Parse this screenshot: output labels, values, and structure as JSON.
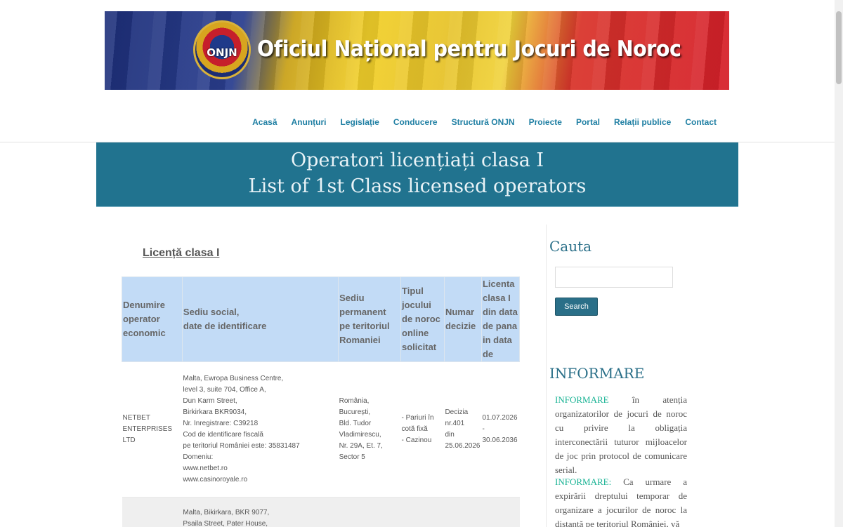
{
  "banner": {
    "seal_label": "ONJN",
    "title": "Oficiul Național pentru Jocuri de Noroc"
  },
  "nav": {
    "items": [
      "Acasă",
      "Anunțuri",
      "Legislație",
      "Conducere",
      "Structură ONJN",
      "Proiecte",
      "Portal",
      "Relații publice",
      "Contact"
    ]
  },
  "page_title": {
    "line1": "Operatori licențiați clasa I",
    "line2": "List of 1st Class licensed operators"
  },
  "main": {
    "heading": "Licență clasa I",
    "table": {
      "headers": [
        "Denumire operator economic",
        "Sediu social,\ndate de identificare",
        "Sediu permanent pe teritoriul Romaniei",
        "Tipul jocului de noroc online solicitat",
        "Numar decizie",
        "Licenta clasa I din data de pana in data de"
      ],
      "rows": [
        [
          "NETBET ENTERPRISES LTD",
          "Malta, Ewropa Business Centre,\nlevel 3, suite 704, Office A,\nDun Karm Street,\nBirkirkara BKR9034,\nNr. Inregistrare: C39218\nCod de identificare fiscală\npe teritoriul României este: 35831487\nDomeniu:\nwww.netbet.ro\nwww.casinoroyale.ro",
          "România,\nBucurești,\nBld. Tudor Vladimirescu,\nNr. 29A, Et. 7,\nSector 5",
          "- Pariuri în cotă fixă\n- Cazinou",
          "Decizia nr.401\ndin 25.06.2026",
          "01.07.2026\n-\n30.06.2036"
        ],
        [
          "",
          "Malta, Bikirkara, BKR 9077,\nPsaila Street, Pater House,",
          "",
          "",
          "",
          ""
        ]
      ]
    }
  },
  "sidebar": {
    "search_heading": "Cauta",
    "search_button": "Search",
    "search_value": "",
    "info_heading": "INFORMARE",
    "info1_label": "INFORMARE",
    "info1_text": "în atenția organizatorilor de jocuri de noroc cu privire la obligația interconectării tuturor mijloacelor de joc prin protocol de comunicare serial.",
    "info2_label": "INFORMARE:",
    "info2_text": "Ca urmare a expirării dreptului temporar de organizare a jocurilor de noroc la distanță pe teritoriul României, vă"
  },
  "colors": {
    "accent": "#21738f",
    "nav_link": "#1f7fa3",
    "table_header": "#c2dbf6",
    "info_highlight": "#19b394"
  }
}
